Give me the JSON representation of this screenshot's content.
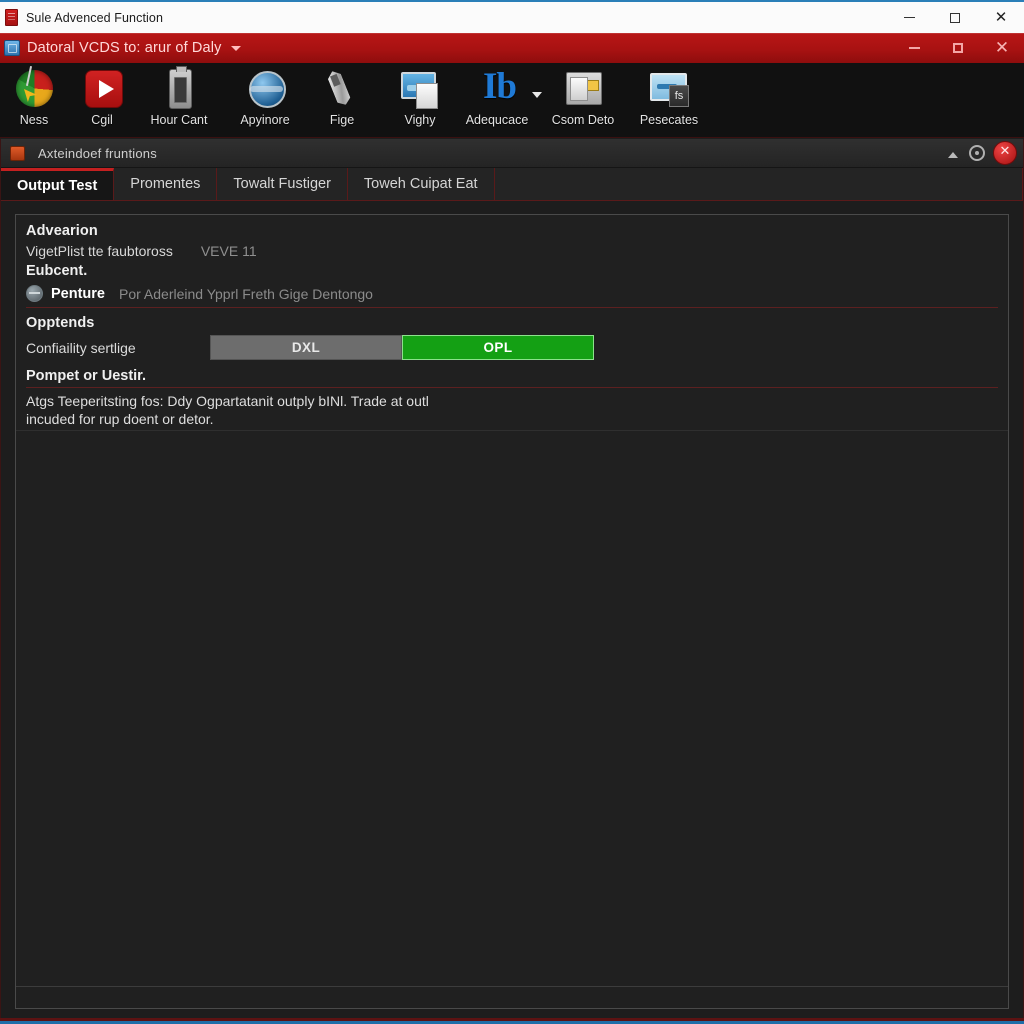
{
  "outer_window": {
    "title": "Sule Advenced Function",
    "icon": "app-red-icon",
    "controls": {
      "minimize": "—",
      "maximize": "□",
      "close": "✕"
    }
  },
  "app_titlebar": {
    "title": "Datoral VCDS to: arur of Daly",
    "icon": "vcds-blue-icon",
    "dropdown_caret": "▾",
    "controls": {
      "minimize": "—",
      "maximize": "□",
      "close": "✕"
    }
  },
  "toolbar": {
    "items": [
      {
        "label": "Ness",
        "icon": "pie-chart-icon"
      },
      {
        "label": "Cgil",
        "icon": "play-icon"
      },
      {
        "label": "Hour Cant",
        "icon": "device-icon"
      },
      {
        "label": "Apyinore",
        "icon": "globe-sync-icon"
      },
      {
        "label": "Fige",
        "icon": "pen-icon"
      },
      {
        "label": "Vighy",
        "icon": "monitor-page-icon"
      },
      {
        "label": "Adequcace",
        "icon": "ib-label-icon",
        "glyph": "Ib",
        "has_dropdown": true
      },
      {
        "label": "Csom Deto",
        "icon": "folder-data-icon"
      },
      {
        "label": "Pesecates",
        "icon": "presets-icon",
        "badge": "fs"
      }
    ]
  },
  "inner_window": {
    "title": "Axteindoef fruntions",
    "icon": "orange-square-icon",
    "controls": {
      "collapse": "chevron-up-icon",
      "settings": "gear-icon",
      "close": "✕"
    }
  },
  "tabs": [
    {
      "label": "Output Test",
      "active": true
    },
    {
      "label": "Promentes",
      "active": false
    },
    {
      "label": "Towalt Fustiger",
      "active": false
    },
    {
      "label": "Toweh Cuipat Eat",
      "active": false
    }
  ],
  "panel": {
    "section_title": "Advearion",
    "field": {
      "label": "VigetPlist tte faubtoross",
      "value": "VEVE 11"
    },
    "subsection_title": "Eubcent.",
    "feature_row": {
      "icon": "module-icon",
      "name": "Penture",
      "description": "Por Aderleind Ypprl Freth Gige Dentongo"
    },
    "options_title": "Opptends",
    "toggle": {
      "label": "Confiaility sertlige",
      "off_label": "DXL",
      "on_label": "OPL",
      "selected": "OPL"
    },
    "note_title": "Pompet or Uestir.",
    "note_body": "Atgs Teeperitsting fos: Ddy Ogpartatanit outply bINl. Trade at outl incuded for rup doent or detor."
  },
  "colors": {
    "accent_red": "#b81616",
    "panel_bg": "#202020",
    "toggle_on_green": "#14a014",
    "toggle_off_gray": "#6d6d6d",
    "tab_active_border": "#c42020",
    "bottom_blue": "#1f6ea8"
  }
}
